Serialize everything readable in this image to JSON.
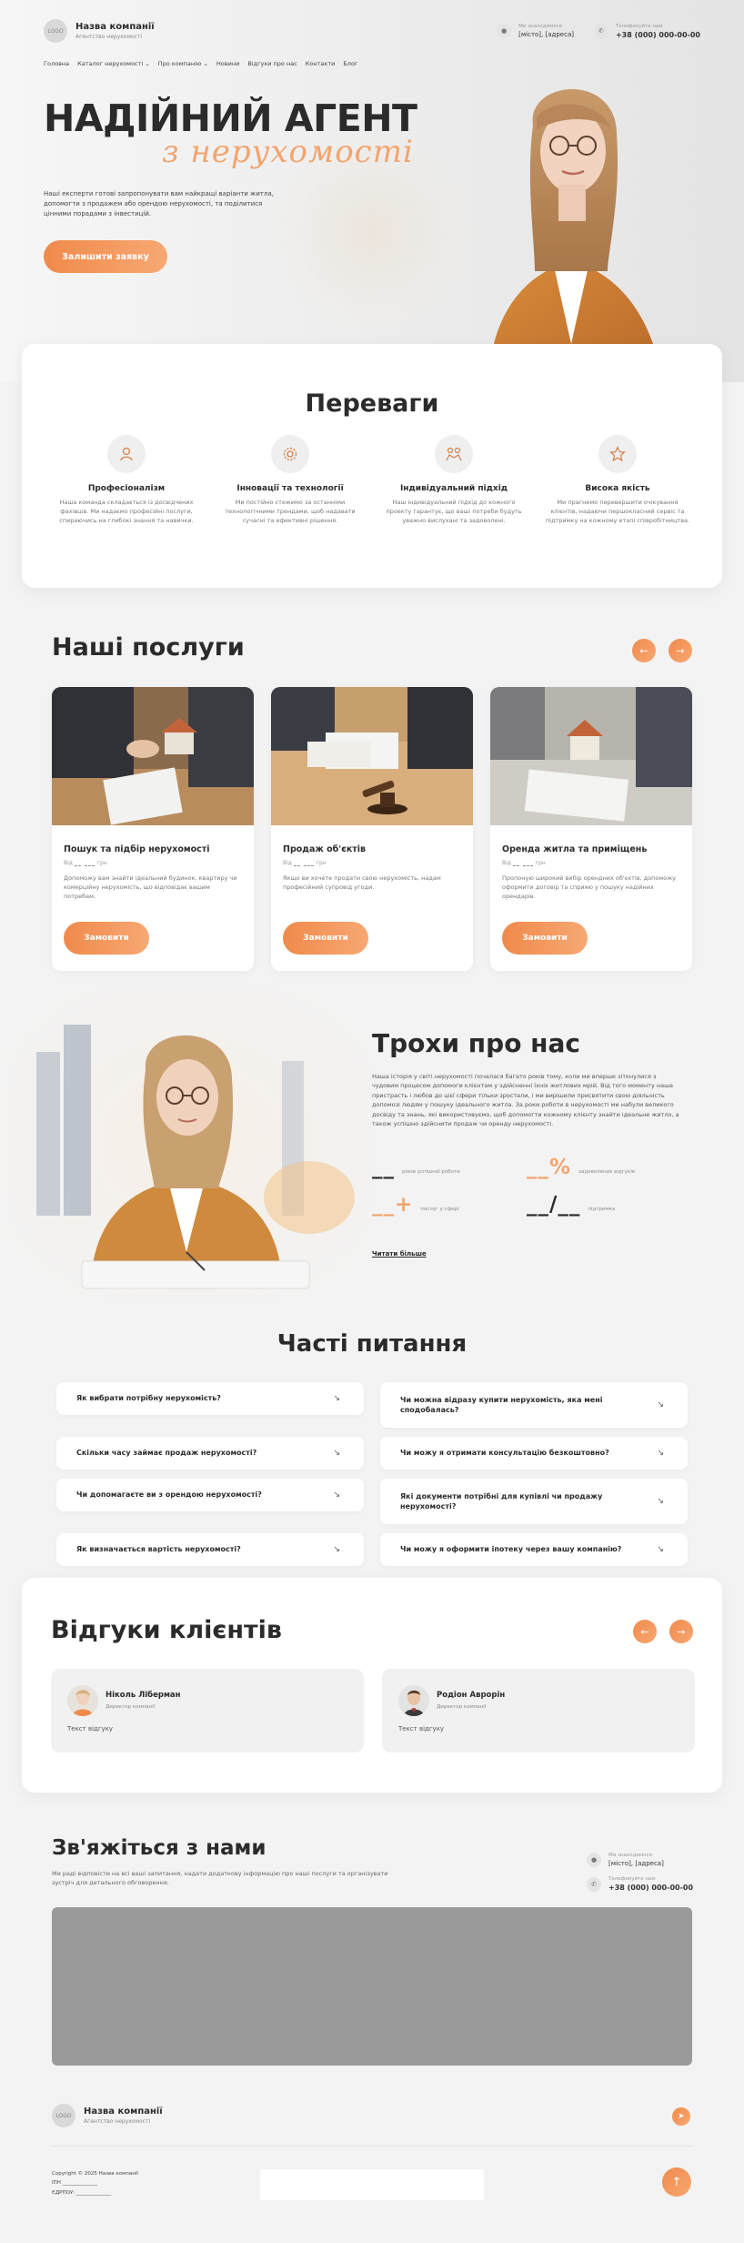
{
  "header": {
    "logo_text": "LOGO",
    "company_name": "Назва компанії",
    "company_sub": "Агентство нерухомості",
    "address_label": "Ми знаходимося",
    "address_value": "[місто], [адреса]",
    "phone_label": "Телефонуйте нам",
    "phone_value": "+38 (000) 000-00-00"
  },
  "nav": {
    "items": [
      "Головна",
      "Каталог нерухомості",
      "Про компанію",
      "Новини",
      "Відгуки про нас",
      "Контакти",
      "Блог"
    ]
  },
  "hero": {
    "title": "НАДІЙНИЙ АГЕНТ",
    "script": "з нерухомості",
    "description": "Наші експерти готові запропонувати вам найкращі варіанти житла, допомогти з продажем або орендою нерухомості, та поділитися цінними порадами з інвестицій.",
    "button": "Залишити заявку"
  },
  "advantages": {
    "title": "Переваги",
    "items": [
      {
        "icon": "person-icon",
        "name": "Професіоналізм",
        "text": "Наша команда складається із досвідчених фахівців. Ми надаємо професійні послуги, спираючись на глибокі знання та навички."
      },
      {
        "icon": "gear-icon",
        "name": "Інновації та технології",
        "text": "Ми постійно стежимо за останніми технологічними трендами, щоб надавати сучасні та ефективні рішення."
      },
      {
        "icon": "handshake-icon",
        "name": "Індивідуальний підхід",
        "text": "Наш індивідуальний підхід до кожного проекту гарантує, що ваші потреби будуть уважно вислухані та задоволені."
      },
      {
        "icon": "star-icon",
        "name": "Висока якість",
        "text": "Ми прагнемо перевершити очікування клієнтів, надаючи першокласний сервіс та підтримку на кожному етапі співробітництва."
      }
    ]
  },
  "services": {
    "title": "Наші послуги",
    "prev": "←",
    "next": "→",
    "items": [
      {
        "name": "Пошук та підбір нерухомості",
        "price_prefix": "Від",
        "price_value": "__ ___",
        "price_unit": "грн",
        "desc": "Допоможу вам знайти ідеальний будинок, квартиру чи комерційну нерухомість, що відповідає вашим потребам.",
        "button": "Замовити"
      },
      {
        "name": "Продаж об'єктів",
        "price_prefix": "Від",
        "price_value": "__ ___",
        "price_unit": "грн",
        "desc": "Якщо ви хочете продати свою нерухомість, надам професійний супровід угоди.",
        "button": "Замовити"
      },
      {
        "name": "Оренда житла та приміщень",
        "price_prefix": "Від",
        "price_value": "__ ___",
        "price_unit": "грн",
        "desc": "Пропоную широкий вибір орендних об'єктів, допоможу оформити договір та сприяю у пошуку надійних орендарів.",
        "button": "Замовити"
      }
    ]
  },
  "about": {
    "title": "Трохи про нас",
    "text": "Наша історія у світі нерухомості почалася багато років тому, коли ми вперше зіткнулися з чудовим процесом допомоги клієнтам у здійсненні їхніх житлових мрій. Від того моменту наша пристрасть і любов до цієї сфери тільки зростали, і ми вирішили присвятити свою діяльність допомозі людям у пошуку ідеального житла. За роки роботи в нерухомості ми набули великого досвіду та знань, які використовуємо, щоб допомогти кожному клієнту знайти ідеальне житло, а також успішно здійснити продаж чи оренду нерухомості.",
    "stats": [
      {
        "value": "__",
        "suffix": "",
        "label": "років успішної роботи"
      },
      {
        "value": "__",
        "suffix": "%",
        "label": "задоволених відгуків"
      },
      {
        "value": "__",
        "suffix": "+",
        "label": "послуг у сфері"
      },
      {
        "value": "__/__",
        "suffix": "",
        "label": "підтримка"
      }
    ],
    "link": "Читати більше"
  },
  "faq": {
    "title": "Часті питання",
    "arrow": "↘",
    "items": [
      "Як вибрати потрібну нерухомість?",
      "Чи можна відразу купити нерухомість, яка мені сподобалась?",
      "Скільки часу займає продаж нерухомості?",
      "Чи можу я отримати консультацію безкоштовно?",
      "Чи допомагаєте ви з орендою нерухомості?",
      "Які документи потрібні для купівлі чи продажу нерухомості?",
      "Як визначається вартість нерухомості?",
      "Чи можу я оформити іпотеку через вашу компанію?"
    ]
  },
  "reviews": {
    "title": "Відгуки клієнтів",
    "items": [
      {
        "name": "Ніколь Ліберман",
        "role": "Директор компанії",
        "text": "Текст відгуку"
      },
      {
        "name": "Родіон Аврорін",
        "role": "Директор компанії",
        "text": "Текст відгуку"
      }
    ]
  },
  "contacts": {
    "title": "Зв'яжіться з нами",
    "desc": "Ми раді відповісти на всі ваші запитання, надати додаткову інформацію про наші послуги та організувати зустріч для детального обговорення.",
    "address_label": "Ми знаходимося",
    "address_value": "[місто], [адреса]",
    "phone_label": "Телефонуйте нам",
    "phone_value": "+38 (000) 000-00-00"
  },
  "footer": {
    "company_name": "Назва компанії",
    "company_sub": "Агентство нерухомості",
    "logo_text": "LOGO",
    "copyright": "Copyright © 2025 Назва компанії",
    "ipn": "ІПН ______________",
    "edrpou": "ЄДРПОУ: ______________",
    "telegram_icon": "➤",
    "up_icon": "↑"
  },
  "colors": {
    "accent": "#f08a4b",
    "accent_light": "#f7a873",
    "background": "#f3f3f3"
  }
}
